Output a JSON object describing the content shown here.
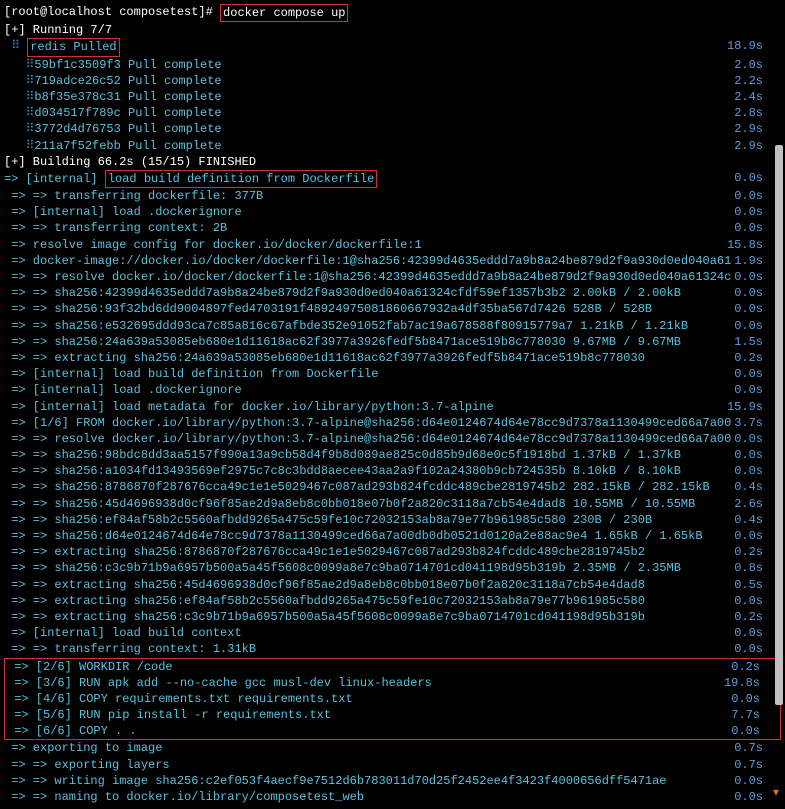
{
  "prompt": {
    "user_host": "[root@localhost composetest]#",
    "command": "docker compose up"
  },
  "running_header": "[+] Running 7/7",
  "redis_pulled": "redis Pulled",
  "redis_time": "18.9s",
  "pull_layers": [
    {
      "hash": "59bf1c3509f3",
      "status": "Pull complete",
      "time": "2.0s"
    },
    {
      "hash": "719adce26c52",
      "status": "Pull complete",
      "time": "2.2s"
    },
    {
      "hash": "b8f35e378c31",
      "status": "Pull complete",
      "time": "2.4s"
    },
    {
      "hash": "d034517f789c",
      "status": "Pull complete",
      "time": "2.8s"
    },
    {
      "hash": "3772d4d76753",
      "status": "Pull complete",
      "time": "2.9s"
    },
    {
      "hash": "211a7f52febb",
      "status": "Pull complete",
      "time": "2.9s"
    }
  ],
  "building_header": "[+] Building 66.2s (15/15) FINISHED",
  "load_build_prefix": "=> [internal]",
  "load_build_def": "load build definition from Dockerfile",
  "build_steps": [
    {
      "text": "=> => transferring dockerfile: 377B",
      "time": "0.0s"
    },
    {
      "text": "=> [internal] load .dockerignore",
      "time": "0.0s"
    },
    {
      "text": "=> => transferring context: 2B",
      "time": "0.0s"
    },
    {
      "text": "=> resolve image config for docker.io/docker/dockerfile:1",
      "time": "15.8s"
    },
    {
      "text": "=> docker-image://docker.io/docker/dockerfile:1@sha256:42399d4635eddd7a9b8a24be879d2f9a930d0ed040a61",
      "time": "1.9s"
    },
    {
      "text": "=> => resolve docker.io/docker/dockerfile:1@sha256:42399d4635eddd7a9b8a24be879d2f9a930d0ed040a61324c",
      "time": "0.0s"
    },
    {
      "text": "=> => sha256:42399d4635eddd7a9b8a24be879d2f9a930d0ed040a61324cfdf59ef1357b3b2 2.00kB / 2.00kB",
      "time": "0.0s"
    },
    {
      "text": "=> => sha256:93f32bd6dd9004897fed4703191f48924975081860667932a4df35ba567d7426 528B / 528B",
      "time": "0.0s"
    },
    {
      "text": "=> => sha256:e532695ddd93ca7c85a816c67afbde352e91052fab7ac19a678588f80915779a7 1.21kB / 1.21kB",
      "time": "0.0s"
    },
    {
      "text": "=> => sha256:24a639a53085eb680e1d11618ac62f3977a3926fedf5b8471ace519b8c778030 9.67MB / 9.67MB",
      "time": "1.5s"
    },
    {
      "text": "=> => extracting sha256:24a639a53085eb680e1d11618ac62f3977a3926fedf5b8471ace519b8c778030",
      "time": "0.2s"
    },
    {
      "text": "=> [internal] load build definition from Dockerfile",
      "time": "0.0s"
    },
    {
      "text": "=> [internal] load .dockerignore",
      "time": "0.0s"
    },
    {
      "text": "=> [internal] load metadata for docker.io/library/python:3.7-alpine",
      "time": "15.9s"
    },
    {
      "text": "=> [1/6] FROM docker.io/library/python:3.7-alpine@sha256:d64e0124674d64e78cc9d7378a1130499ced66a7a00",
      "time": "3.7s"
    },
    {
      "text": "=> => resolve docker.io/library/python:3.7-alpine@sha256:d64e0124674d64e78cc9d7378a1130499ced66a7a00",
      "time": "0.0s"
    },
    {
      "text": "=> => sha256:98bdc8dd3aa5157f990a13a9cb58d4f9b8d089ae825c0d85b9d68e0c5f1918bd 1.37kB / 1.37kB",
      "time": "0.0s"
    },
    {
      "text": "=> => sha256:a1034fd13493569ef2975c7c8c3bdd8aecee43aa2a9f102a24380b9cb724535b 8.10kB / 8.10kB",
      "time": "0.0s"
    },
    {
      "text": "=> => sha256:8786870f287676cca49c1e1e5029467c087ad293b824fcddc489cbe2819745b2 282.15kB / 282.15kB",
      "time": "0.4s"
    },
    {
      "text": "=> => sha256:45d4696938d0cf96f85ae2d9a8eb8c0bb018e07b0f2a820c3118a7cb54e4dad8 10.55MB / 10.55MB",
      "time": "2.6s"
    },
    {
      "text": "=> => sha256:ef84af58b2c5560afbdd9265a475c59fe10c72032153ab8a79e77b961985c580 230B / 230B",
      "time": "0.4s"
    },
    {
      "text": "=> => sha256:d64e0124674d64e78cc9d7378a1130499ced66a7a00db0db0521d0120a2e88ac9e4 1.65kB / 1.65kB",
      "time": "0.0s"
    },
    {
      "text": "=> => extracting sha256:8786870f287676cca49c1e1e5029467c087ad293b824fcddc489cbe2819745b2",
      "time": "0.2s"
    },
    {
      "text": "=> => sha256:c3c9b71b9a6957b500a5a45f5608c0099a8e7c9ba0714701cd041198d95b319b 2.35MB / 2.35MB",
      "time": "0.8s"
    },
    {
      "text": "=> => extracting sha256:45d4696938d0cf96f85ae2d9a8eb8c0bb018e07b0f2a820c3118a7cb54e4dad8",
      "time": "0.5s"
    },
    {
      "text": "=> => extracting sha256:ef84af58b2c5560afbdd9265a475c59fe10c72032153ab8a79e77b961985c580",
      "time": "0.0s"
    },
    {
      "text": "=> => extracting sha256:c3c9b71b9a6957b500a5a45f5608c0099a8e7c9ba0714701cd041198d95b319b",
      "time": "0.2s"
    },
    {
      "text": "=> [internal] load build context",
      "time": "0.0s"
    },
    {
      "text": "=> => transferring context: 1.31kB",
      "time": "0.0s"
    }
  ],
  "dockerfile_steps": [
    {
      "text": "=> [2/6] WORKDIR /code",
      "time": "0.2s"
    },
    {
      "text": "=> [3/6] RUN apk add --no-cache gcc musl-dev linux-headers",
      "time": "19.8s"
    },
    {
      "text": "=> [4/6] COPY requirements.txt requirements.txt",
      "time": "0.0s"
    },
    {
      "text": "=> [5/6] RUN pip install -r requirements.txt",
      "time": "7.7s"
    },
    {
      "text": "=> [6/6] COPY . .",
      "time": "0.0s"
    }
  ],
  "export_steps": [
    {
      "text": "=> exporting to image",
      "time": "0.7s"
    },
    {
      "text": "=> => exporting layers",
      "time": "0.7s"
    },
    {
      "text": "=> => writing image sha256:c2ef053f4aecf9e7512d6b783011d70d25f2452ee4f3423f4000656dff5471ae",
      "time": "0.0s"
    },
    {
      "text": "=> => naming to docker.io/library/composetest_web",
      "time": "0.0s"
    }
  ],
  "load_build_time": "0.0s"
}
